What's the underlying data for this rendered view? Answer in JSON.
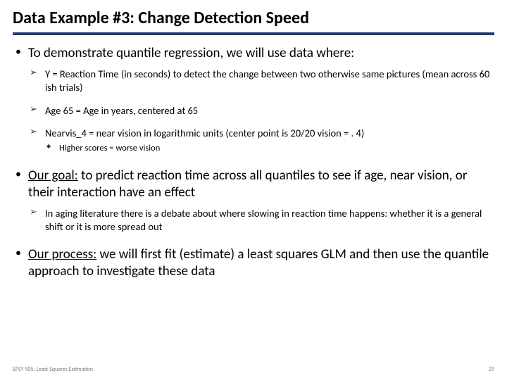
{
  "title": "Data Example #3: Change Detection Speed",
  "b1": {
    "text": "To demonstrate quantile regression, we will use data where:",
    "subs": {
      "s1": "Y = Reaction Time (in seconds) to detect the change between two otherwise same pictures (mean across 60 ish trials)",
      "s2": "Age 65 = Age in years, centered at 65",
      "s3": "Nearvis_4 = near vision in logarithmic units (center point is 20/20 vision = . 4)",
      "s3a": "Higher scores = worse vision"
    }
  },
  "b2": {
    "lead": "Our goal:",
    "rest": " to predict reaction time across all quantiles to see if age, near vision, or their interaction have an effect",
    "sub1": "In aging literature there is a debate about where slowing in reaction time happens: whether it is a general shift or it is more spread out"
  },
  "b3": {
    "lead": "Our process:",
    "rest": " we will first fit (estimate) a least squares GLM and then use the quantile approach to investigate these data"
  },
  "footer": {
    "left": "EPSY 905: Least Squares Estimation",
    "right": "29"
  }
}
